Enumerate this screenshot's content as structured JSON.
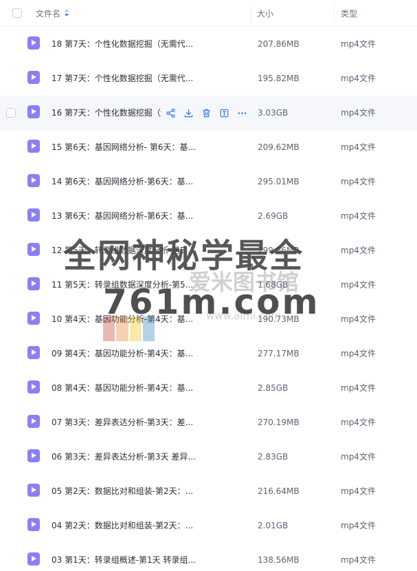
{
  "header": {
    "name_label": "文件名",
    "size_label": "大小",
    "type_label": "类型"
  },
  "files": [
    {
      "name": "18 第7天：个性化数据挖掘（无需代...",
      "size": "207.86MB",
      "type": "mp4文件"
    },
    {
      "name": "17 第7天：个性化数据挖掘（无需代...",
      "size": "195.82MB",
      "type": "mp4文件"
    },
    {
      "name": "16 第7天：个性化数据挖掘（无需代...",
      "size": "3.03GB",
      "type": "mp4文件"
    },
    {
      "name": "15 第6天：基因网络分析- 第6天：基...",
      "size": "209.62MB",
      "type": "mp4文件"
    },
    {
      "name": "14 第6天：基因网络分析-第6天：基...",
      "size": "295.01MB",
      "type": "mp4文件"
    },
    {
      "name": "13 第6天：基因网络分析-第6天：基...",
      "size": "2.69GB",
      "type": "mp4文件"
    },
    {
      "name": "12 第5天：转录组数据深度分析-第5...",
      "size": "299.86MB",
      "type": "mp4文件"
    },
    {
      "name": "11 第5天：转录组数据深度分析-第5...",
      "size": "1.68GB",
      "type": "mp4文件"
    },
    {
      "name": "10 第4天：基因功能分析-第4天：基...",
      "size": "190.73MB",
      "type": "mp4文件"
    },
    {
      "name": "09 第4天：基因功能分析-第4天：基...",
      "size": "277.17MB",
      "type": "mp4文件"
    },
    {
      "name": "08 第4天：基因功能分析-第4天：基...",
      "size": "2.85GB",
      "type": "mp4文件"
    },
    {
      "name": "07 第3天：差异表达分析-第3天：差...",
      "size": "270.19MB",
      "type": "mp4文件"
    },
    {
      "name": "06 第3天：差异表达分析-第3天 差异...",
      "size": "2.83GB",
      "type": "mp4文件"
    },
    {
      "name": "05 第2天：数据比对和组装-第2天：...",
      "size": "216.64MB",
      "type": "mp4文件"
    },
    {
      "name": "04 第2天：数据比对和组装-第2天：...",
      "size": "2.01GB",
      "type": "mp4文件"
    },
    {
      "name": "03 第1天：转录组概述-第1天 转录组...",
      "size": "138.56MB",
      "type": "mp4文件"
    }
  ],
  "hover_row_index": 2,
  "row_actions": [
    "share-icon",
    "download-icon",
    "delete-icon",
    "rename-icon",
    "more-icon"
  ],
  "colors": {
    "accent": "#3b82f6",
    "video_icon": "#8a7ff5",
    "hover_row": "#f5f7fb"
  },
  "watermark": {
    "title": "全网神秘学最全",
    "subtitle": "爱米图书馆",
    "domain": "761m.com",
    "url": "www.aimi.com"
  }
}
